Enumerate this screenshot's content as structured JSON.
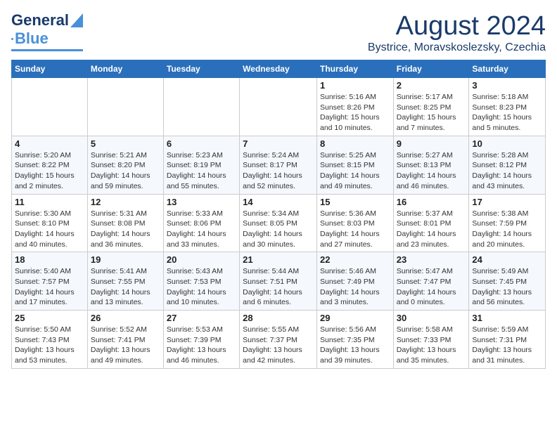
{
  "header": {
    "logo_general": "General",
    "logo_blue": "Blue",
    "main_title": "August 2024",
    "subtitle": "Bystrice, Moravskoslezsky, Czechia"
  },
  "calendar": {
    "days_of_week": [
      "Sunday",
      "Monday",
      "Tuesday",
      "Wednesday",
      "Thursday",
      "Friday",
      "Saturday"
    ],
    "weeks": [
      [
        {
          "day": "",
          "info": ""
        },
        {
          "day": "",
          "info": ""
        },
        {
          "day": "",
          "info": ""
        },
        {
          "day": "",
          "info": ""
        },
        {
          "day": "1",
          "info": "Sunrise: 5:16 AM\nSunset: 8:26 PM\nDaylight: 15 hours\nand 10 minutes."
        },
        {
          "day": "2",
          "info": "Sunrise: 5:17 AM\nSunset: 8:25 PM\nDaylight: 15 hours\nand 7 minutes."
        },
        {
          "day": "3",
          "info": "Sunrise: 5:18 AM\nSunset: 8:23 PM\nDaylight: 15 hours\nand 5 minutes."
        }
      ],
      [
        {
          "day": "4",
          "info": "Sunrise: 5:20 AM\nSunset: 8:22 PM\nDaylight: 15 hours\nand 2 minutes."
        },
        {
          "day": "5",
          "info": "Sunrise: 5:21 AM\nSunset: 8:20 PM\nDaylight: 14 hours\nand 59 minutes."
        },
        {
          "day": "6",
          "info": "Sunrise: 5:23 AM\nSunset: 8:19 PM\nDaylight: 14 hours\nand 55 minutes."
        },
        {
          "day": "7",
          "info": "Sunrise: 5:24 AM\nSunset: 8:17 PM\nDaylight: 14 hours\nand 52 minutes."
        },
        {
          "day": "8",
          "info": "Sunrise: 5:25 AM\nSunset: 8:15 PM\nDaylight: 14 hours\nand 49 minutes."
        },
        {
          "day": "9",
          "info": "Sunrise: 5:27 AM\nSunset: 8:13 PM\nDaylight: 14 hours\nand 46 minutes."
        },
        {
          "day": "10",
          "info": "Sunrise: 5:28 AM\nSunset: 8:12 PM\nDaylight: 14 hours\nand 43 minutes."
        }
      ],
      [
        {
          "day": "11",
          "info": "Sunrise: 5:30 AM\nSunset: 8:10 PM\nDaylight: 14 hours\nand 40 minutes."
        },
        {
          "day": "12",
          "info": "Sunrise: 5:31 AM\nSunset: 8:08 PM\nDaylight: 14 hours\nand 36 minutes."
        },
        {
          "day": "13",
          "info": "Sunrise: 5:33 AM\nSunset: 8:06 PM\nDaylight: 14 hours\nand 33 minutes."
        },
        {
          "day": "14",
          "info": "Sunrise: 5:34 AM\nSunset: 8:05 PM\nDaylight: 14 hours\nand 30 minutes."
        },
        {
          "day": "15",
          "info": "Sunrise: 5:36 AM\nSunset: 8:03 PM\nDaylight: 14 hours\nand 27 minutes."
        },
        {
          "day": "16",
          "info": "Sunrise: 5:37 AM\nSunset: 8:01 PM\nDaylight: 14 hours\nand 23 minutes."
        },
        {
          "day": "17",
          "info": "Sunrise: 5:38 AM\nSunset: 7:59 PM\nDaylight: 14 hours\nand 20 minutes."
        }
      ],
      [
        {
          "day": "18",
          "info": "Sunrise: 5:40 AM\nSunset: 7:57 PM\nDaylight: 14 hours\nand 17 minutes."
        },
        {
          "day": "19",
          "info": "Sunrise: 5:41 AM\nSunset: 7:55 PM\nDaylight: 14 hours\nand 13 minutes."
        },
        {
          "day": "20",
          "info": "Sunrise: 5:43 AM\nSunset: 7:53 PM\nDaylight: 14 hours\nand 10 minutes."
        },
        {
          "day": "21",
          "info": "Sunrise: 5:44 AM\nSunset: 7:51 PM\nDaylight: 14 hours\nand 6 minutes."
        },
        {
          "day": "22",
          "info": "Sunrise: 5:46 AM\nSunset: 7:49 PM\nDaylight: 14 hours\nand 3 minutes."
        },
        {
          "day": "23",
          "info": "Sunrise: 5:47 AM\nSunset: 7:47 PM\nDaylight: 14 hours\nand 0 minutes."
        },
        {
          "day": "24",
          "info": "Sunrise: 5:49 AM\nSunset: 7:45 PM\nDaylight: 13 hours\nand 56 minutes."
        }
      ],
      [
        {
          "day": "25",
          "info": "Sunrise: 5:50 AM\nSunset: 7:43 PM\nDaylight: 13 hours\nand 53 minutes."
        },
        {
          "day": "26",
          "info": "Sunrise: 5:52 AM\nSunset: 7:41 PM\nDaylight: 13 hours\nand 49 minutes."
        },
        {
          "day": "27",
          "info": "Sunrise: 5:53 AM\nSunset: 7:39 PM\nDaylight: 13 hours\nand 46 minutes."
        },
        {
          "day": "28",
          "info": "Sunrise: 5:55 AM\nSunset: 7:37 PM\nDaylight: 13 hours\nand 42 minutes."
        },
        {
          "day": "29",
          "info": "Sunrise: 5:56 AM\nSunset: 7:35 PM\nDaylight: 13 hours\nand 39 minutes."
        },
        {
          "day": "30",
          "info": "Sunrise: 5:58 AM\nSunset: 7:33 PM\nDaylight: 13 hours\nand 35 minutes."
        },
        {
          "day": "31",
          "info": "Sunrise: 5:59 AM\nSunset: 7:31 PM\nDaylight: 13 hours\nand 31 minutes."
        }
      ]
    ]
  }
}
